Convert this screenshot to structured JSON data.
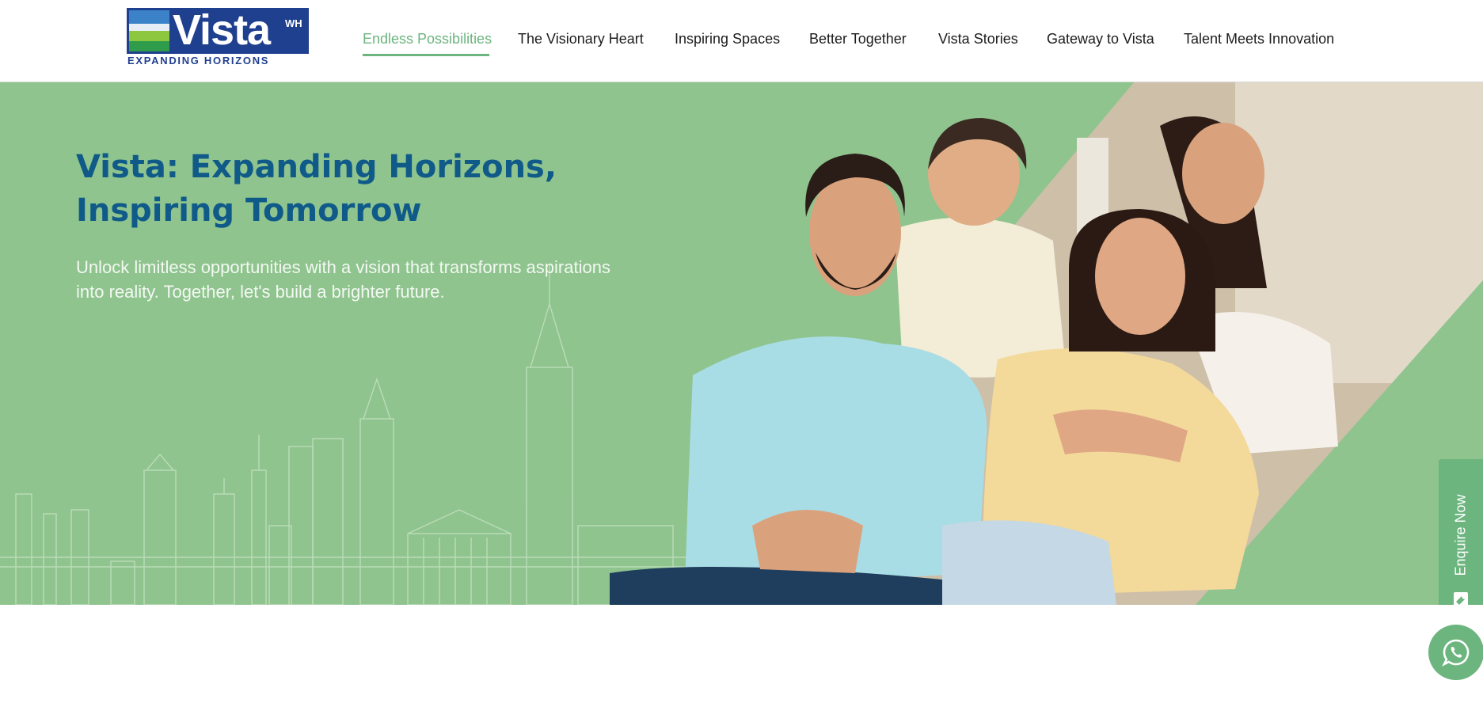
{
  "logo": {
    "wordmark": "Vista",
    "superscript": "WH",
    "tagline": "EXPANDING HORIZONS",
    "brand_color": "#1f3f8f"
  },
  "nav": {
    "items": [
      {
        "label": "Endless Possibilities",
        "active": true
      },
      {
        "label": "The Visionary Heart",
        "active": false
      },
      {
        "label": "Inspiring Spaces",
        "active": false
      },
      {
        "label": "Better Together",
        "active": false
      },
      {
        "label": "Vista Stories",
        "active": false
      },
      {
        "label": "Gateway to Vista",
        "active": false
      },
      {
        "label": "Talent Meets Innovation",
        "active": false
      }
    ],
    "active_color": "#6cb57f"
  },
  "hero": {
    "title": "Vista: Expanding Horizons, Inspiring Tomorrow",
    "subtitle": "Unlock limitless opportunities with a vision that transforms aspirations into reality. Together, let's build a brighter future.",
    "background_color": "#8fc48e",
    "title_color": "#0f5a88",
    "image": "family-photo"
  },
  "enquire": {
    "label": "Enquire Now",
    "icon": "mail-icon"
  },
  "whatsapp": {
    "icon": "whatsapp-icon"
  }
}
